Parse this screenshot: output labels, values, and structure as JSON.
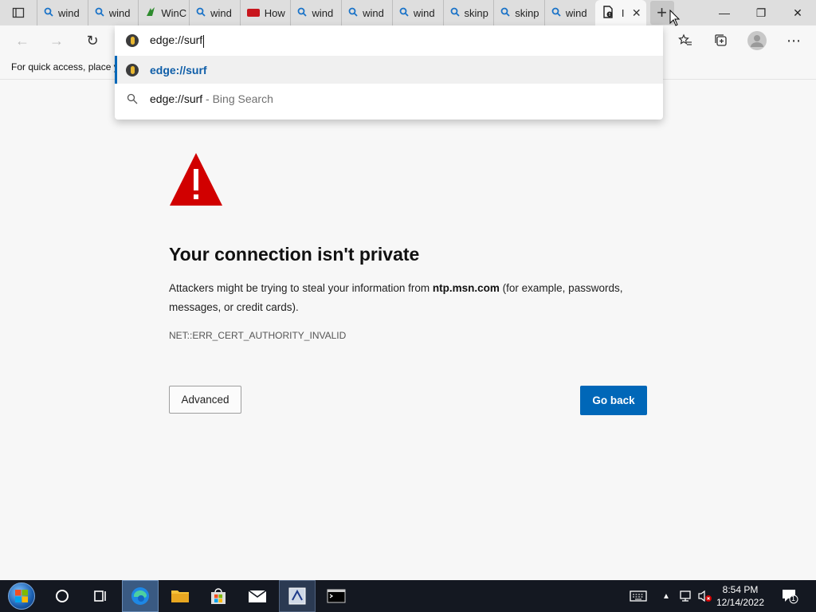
{
  "tabs": [
    {
      "label": "wind",
      "icon": "search-icon"
    },
    {
      "label": "wind",
      "icon": "search-icon"
    },
    {
      "label": "WinC",
      "icon": "site-leaf-icon"
    },
    {
      "label": "wind",
      "icon": "search-icon"
    },
    {
      "label": "How",
      "icon": "site-red-badge-icon"
    },
    {
      "label": "wind",
      "icon": "search-icon"
    },
    {
      "label": "wind",
      "icon": "search-icon"
    },
    {
      "label": "wind",
      "icon": "search-icon"
    },
    {
      "label": "skinp",
      "icon": "search-icon"
    },
    {
      "label": "skinp",
      "icon": "search-icon"
    },
    {
      "label": "wind",
      "icon": "search-icon"
    }
  ],
  "active_tab": {
    "label": "I",
    "icon": "page-warning-icon",
    "close": "✕"
  },
  "newtab_label": "+",
  "window_controls": {
    "minimize": "—",
    "restore": "❐",
    "close": "✕"
  },
  "favorites_bar": {
    "text": "For quick access, place y"
  },
  "omnibox": {
    "value": "edge://surf",
    "suggestions": [
      {
        "text": "edge://surf",
        "sub": "",
        "icon": "edge-page-icon",
        "selected": true
      },
      {
        "text": "edge://surf",
        "sub": " - Bing Search",
        "icon": "search-icon",
        "selected": false
      }
    ]
  },
  "error_page": {
    "title": "Your connection isn't private",
    "desc_before": "Attackers might be trying to steal your information from ",
    "desc_host": "ntp.msn.com",
    "desc_after": " (for example, passwords, messages, or credit cards).",
    "code": "NET::ERR_CERT_AUTHORITY_INVALID",
    "advanced_label": "Advanced",
    "goback_label": "Go back"
  },
  "taskbar": {
    "clock_time": "8:54 PM",
    "clock_date": "12/14/2022",
    "notification_count": "1"
  },
  "colors": {
    "accent": "#0067b8",
    "warning": "#d10000",
    "taskbar": "#141821"
  }
}
